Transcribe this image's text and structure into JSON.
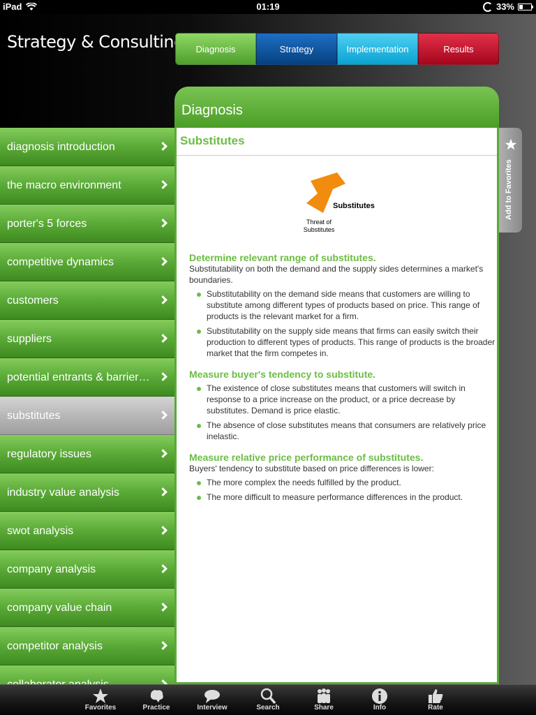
{
  "status": {
    "device": "iPad",
    "time": "01:19",
    "battery": "33%"
  },
  "app_title": "Strategy & Consulting",
  "tabs": [
    {
      "label": "Diagnosis",
      "color": "#6cbd45"
    },
    {
      "label": "Strategy",
      "color": "#0b4f99"
    },
    {
      "label": "Implementation",
      "color": "#18b7e2"
    },
    {
      "label": "Results",
      "color": "#c8102e"
    }
  ],
  "menu": {
    "items": [
      {
        "label": "diagnosis introduction"
      },
      {
        "label": "the macro environment"
      },
      {
        "label": "porter's 5 forces"
      },
      {
        "label": "competitive dynamics"
      },
      {
        "label": "customers"
      },
      {
        "label": "suppliers"
      },
      {
        "label": "potential entrants & barrier…"
      },
      {
        "label": "substitutes",
        "active": true
      },
      {
        "label": "regulatory issues"
      },
      {
        "label": "industry value analysis"
      },
      {
        "label": "swot analysis"
      },
      {
        "label": "company analysis"
      },
      {
        "label": "company value chain"
      },
      {
        "label": "competitor analysis"
      },
      {
        "label": "collaborator analysis"
      }
    ]
  },
  "panel": {
    "heading": "Diagnosis",
    "title": "Substitutes",
    "diagram": {
      "arrow_label": "Substitutes",
      "sub_label": "Threat of Substitutes"
    },
    "sections": [
      {
        "heading": "Determine relevant range of substitutes.",
        "intro": "Substitutability on both the demand and the supply sides determines a market's boundaries.",
        "bullets": [
          "Substitutability on the demand side means that customers are willing to substitute among different types of products based on price. This range of products is the relevant market for a firm.",
          "Substitutability on the supply side means that firms can easily switch their production to different types of products. This range of products is the broader market that the firm competes in."
        ]
      },
      {
        "heading": "Measure buyer's tendency to substitute.",
        "intro": "",
        "bullets": [
          "The existence of close substitutes means that customers will switch in response to a price increase on the product, or a price decrease by substitutes. Demand is price elastic.",
          "The absence of close substitutes means that consumers are relatively price inelastic."
        ]
      },
      {
        "heading": "Measure relative price performance of substitutes.",
        "intro": "Buyers' tendency to substitute based on price differences is lower:",
        "bullets": [
          "The more complex the needs fulfilled by the product.",
          "The more difficult to measure performance differences in the product."
        ]
      }
    ]
  },
  "favorites_tab": {
    "label": "Add to Favorites",
    "icon": "star-icon"
  },
  "tabbar": {
    "items": [
      {
        "label": "Favorites",
        "icon": "star-icon"
      },
      {
        "label": "Practice",
        "icon": "brain-icon"
      },
      {
        "label": "Interview",
        "icon": "chat-bubble-icon"
      },
      {
        "label": "Search",
        "icon": "search-icon"
      },
      {
        "label": "Share",
        "icon": "people-icon"
      },
      {
        "label": "Info",
        "icon": "info-icon"
      },
      {
        "label": "Rate",
        "icon": "thumbs-up-icon"
      }
    ]
  }
}
